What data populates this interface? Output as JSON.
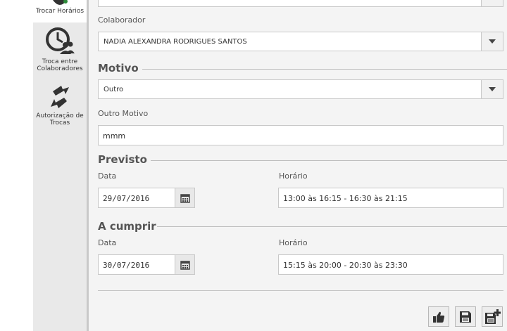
{
  "sidebar": {
    "items": [
      {
        "label": "Trocar Horários",
        "icon": "calendar-swap-icon"
      },
      {
        "label": "Troca entre Colaboradores",
        "icon": "clock-people-icon"
      },
      {
        "label": "Autorização de Trocas",
        "icon": "swap-arrows-icon"
      }
    ]
  },
  "form": {
    "colaborador_label": "Colaborador",
    "colaborador_value": "NADIA ALEXANDRA RODRIGUES SANTOS",
    "motivo_title": "Motivo",
    "motivo_value": "Outro",
    "outro_motivo_label": "Outro Motivo",
    "outro_motivo_value": "mmm",
    "previsto": {
      "title": "Previsto",
      "data_label": "Data",
      "data_value": "29/07/2016",
      "horario_label": "Horário",
      "horario_value": "13:00 às 16:15 - 16:30 às 21:15"
    },
    "a_cumprir": {
      "title": "A cumprir",
      "data_label": "Data",
      "data_value": "30/07/2016",
      "horario_label": "Horário",
      "horario_value": "15:15 às 20:00 - 20:30 às 23:30"
    }
  },
  "actions": [
    {
      "name": "approve-button",
      "icon": "thumbs-up-icon"
    },
    {
      "name": "save-button",
      "icon": "save-icon"
    },
    {
      "name": "save-new-button",
      "icon": "save-add-icon"
    }
  ]
}
